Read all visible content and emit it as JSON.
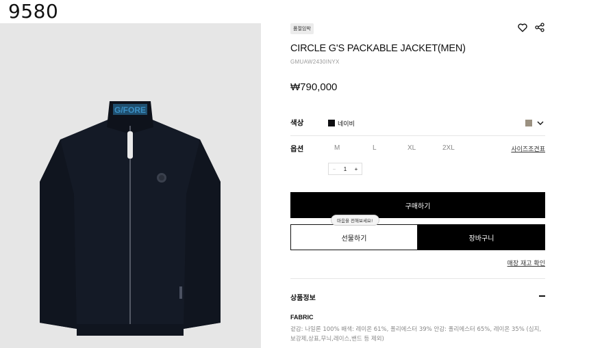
{
  "page_id": "9580",
  "product": {
    "badge": "품절임박",
    "title": "CIRCLE G'S PACKABLE JACKET(MEN)",
    "code": "GMUAW2430INYX",
    "price": "₩790,000"
  },
  "color": {
    "label": "색상",
    "selected": "네이비",
    "options_colors": [
      "#0f0f12",
      "#9b9181"
    ]
  },
  "options": {
    "label": "옵션",
    "sizes": [
      "M",
      "L",
      "XL",
      "2XL"
    ],
    "size_guide": "사이즈조견표"
  },
  "quantity": {
    "minus": "−",
    "value": "1",
    "plus": "+"
  },
  "actions": {
    "buy": "구매하기",
    "tooltip": "마음을 전해보세요!",
    "gift": "선물하기",
    "cart": "장바구니",
    "stock_check": "매장 재고 확인"
  },
  "info": {
    "section_title": "상품정보",
    "fabric_heading": "FABRIC",
    "fabric_text": "겉감: 나일론 100% 배색: 레이온 61%, 폴리에스터 39% 안감: 폴리에스터 65%, 레이온 35% (심지,보강제,상표,무늬,레이스,밴드 등 제외)"
  },
  "image": {
    "collar_text": "G/FORE"
  }
}
